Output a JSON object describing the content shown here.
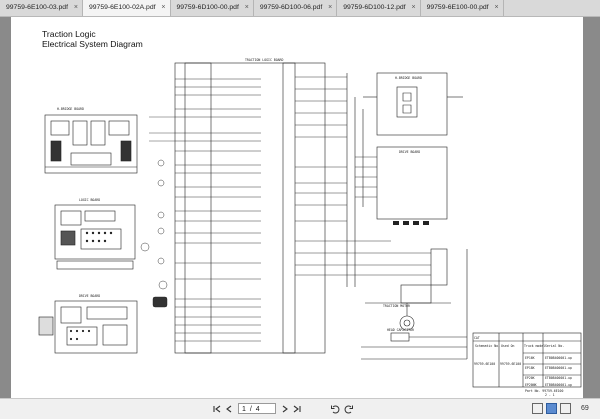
{
  "tabs": [
    {
      "label": "99759-6E100-03.pdf",
      "active": false
    },
    {
      "label": "99759-6E100-02A.pdf",
      "active": true
    },
    {
      "label": "99759-6D100-00.pdf",
      "active": false
    },
    {
      "label": "99759-6D100-06.pdf",
      "active": false
    },
    {
      "label": "99759-6D100-12.pdf",
      "active": false
    },
    {
      "label": "99759-6E100-00.pdf",
      "active": false
    }
  ],
  "tab_close_glyph": "×",
  "document": {
    "title_line1": "Traction Logic",
    "title_line2": "Electrical System Diagram",
    "labels": {
      "hbridge_left": "H-BRIDGE BOARD",
      "logic_board": "LOGIC BOARD",
      "drive_board_left": "DRIVE BOARD",
      "traction_logic_board": "TRACTION LOGIC BOARD",
      "hbridge_right": "H-BRIDGE BOARD",
      "drive_board_right": "DRIVE BOARD",
      "traction_motor": "TRACTION MOTOR",
      "head_capacitor": "HEAD CAPACITOR",
      "cat": "CAT",
      "part_no": "Part No. 99759-6E100",
      "page_indicator": "2 - 1"
    },
    "parts_table": {
      "headers": [
        "Schematic No.",
        "Used On",
        "Truck model",
        "Serial No."
      ],
      "schematic_no": "99759-6E100",
      "used_on": "99759-6E100",
      "rows": [
        [
          "EP16K",
          "ETB0B400001-up"
        ],
        [
          "EP18K",
          "ETB0B400001-up"
        ],
        [
          "EP20K",
          "ETB0B400001-up"
        ],
        [
          "EP20NK",
          "ETB0B400001-up"
        ]
      ]
    }
  },
  "toolbar": {
    "page_current": "1",
    "page_separator": "/",
    "page_total": "4",
    "zoom_label": "69"
  },
  "icons": {
    "first_page": "first-page-icon",
    "prev_page": "prev-page-icon",
    "next_page": "next-page-icon",
    "last_page": "last-page-icon",
    "rotate_ccw": "rotate-ccw-icon",
    "rotate_cw": "rotate-cw-icon",
    "single_page_view": "single-page-view-icon",
    "continuous_view": "continuous-view-icon",
    "facing_view": "facing-view-icon"
  }
}
